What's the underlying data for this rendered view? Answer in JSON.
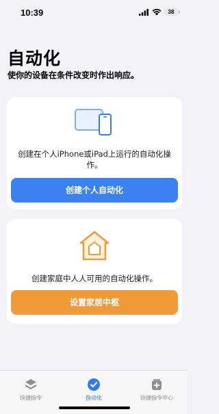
{
  "status_bar": {
    "time": "10:39",
    "battery": "38"
  },
  "page": {
    "title": "自动化",
    "subtitle": "使你的设备在条件改变时作出响应。"
  },
  "cards": {
    "personal": {
      "icon": "devices-icon",
      "description": "创建在个人iPhone或iPad上运行的自动化操作。",
      "button_label": "创建个人自动化",
      "button_color": "#3b82f0"
    },
    "home": {
      "icon": "home-icon",
      "description": "创建家庭中人人可用的自动化操作。",
      "button_label": "设置家居中枢",
      "button_color": "#f09a3a"
    }
  },
  "tab_bar": {
    "items": [
      {
        "label": "快捷指令",
        "icon": "layers-icon",
        "active": false
      },
      {
        "label": "自动化",
        "icon": "checkmark-clock-icon",
        "active": true
      },
      {
        "label": "快捷指令中心",
        "icon": "gallery-icon",
        "active": false
      }
    ],
    "active_color": "#2f7cf6"
  }
}
